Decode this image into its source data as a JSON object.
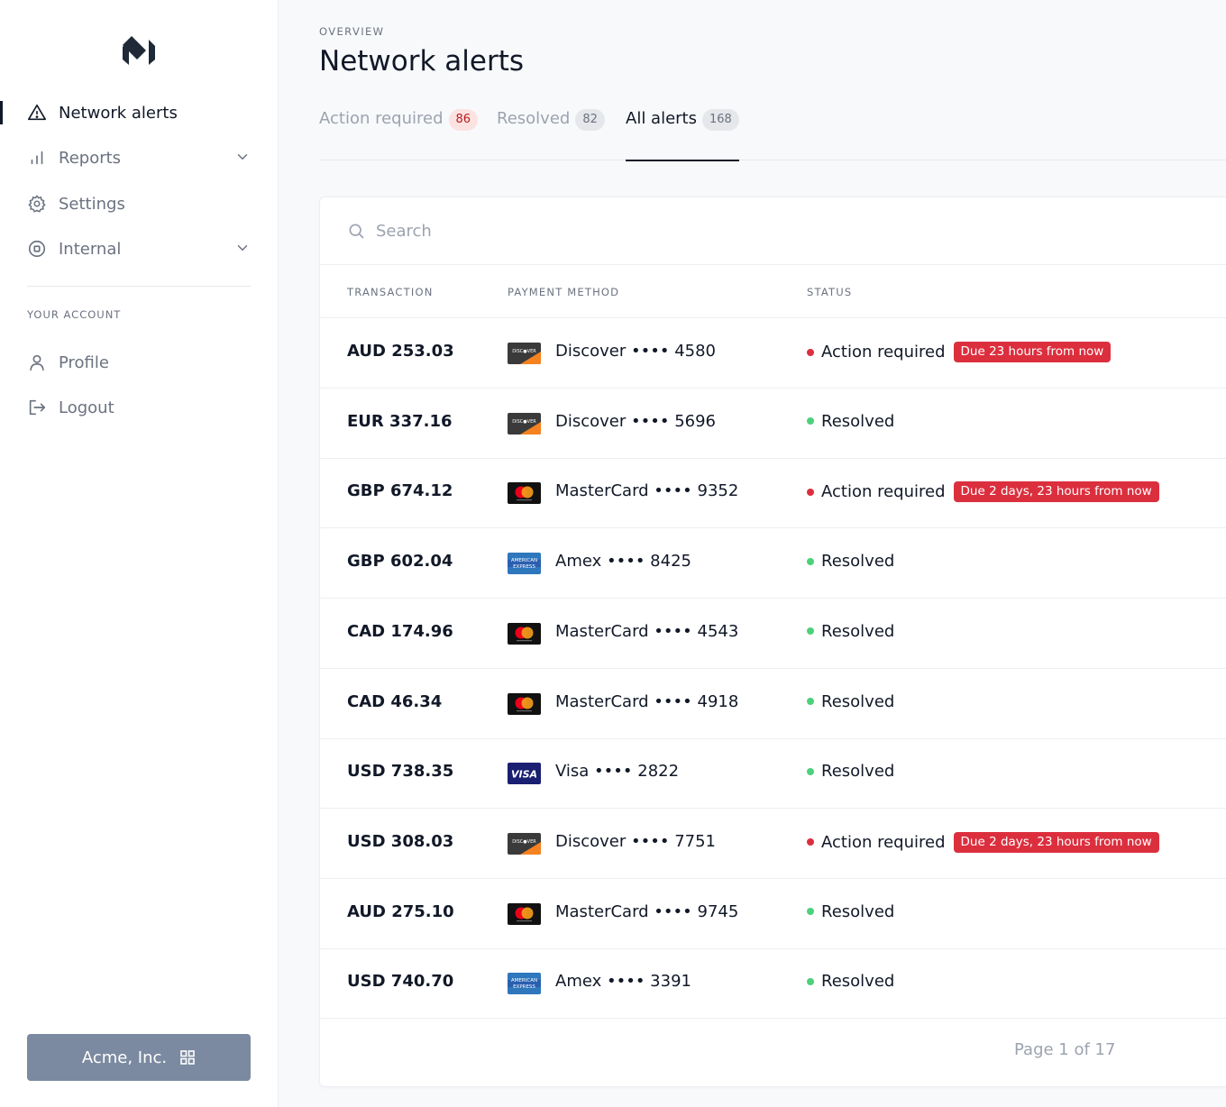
{
  "sidebar": {
    "nav": [
      {
        "label": "Network alerts",
        "icon": "alert-triangle-icon",
        "active": true
      },
      {
        "label": "Reports",
        "icon": "bar-chart-icon",
        "expandable": true
      },
      {
        "label": "Settings",
        "icon": "gear-icon"
      },
      {
        "label": "Internal",
        "icon": "stop-circle-icon",
        "expandable": true
      }
    ],
    "account_section_label": "YOUR ACCOUNT",
    "account_nav": [
      {
        "label": "Profile",
        "icon": "user-icon"
      },
      {
        "label": "Logout",
        "icon": "logout-icon"
      }
    ],
    "org_button_label": "Acme, Inc."
  },
  "header": {
    "eyebrow": "OVERVIEW",
    "title": "Network alerts"
  },
  "tabs": [
    {
      "label": "Action required",
      "count": "86",
      "count_style": "red"
    },
    {
      "label": "Resolved",
      "count": "82",
      "count_style": "gray"
    },
    {
      "label": "All alerts",
      "count": "168",
      "count_style": "gray",
      "active": true
    }
  ],
  "search": {
    "placeholder": "Search",
    "value": ""
  },
  "table": {
    "columns": [
      "TRANSACTION",
      "PAYMENT METHOD",
      "STATUS"
    ],
    "rows": [
      {
        "amount": "AUD 253.03",
        "brand": "discover",
        "method": "Discover •••• 4580",
        "status": "Action required",
        "due": "Due 23 hours from now"
      },
      {
        "amount": "EUR 337.16",
        "brand": "discover",
        "method": "Discover •••• 5696",
        "status": "Resolved",
        "due": ""
      },
      {
        "amount": "GBP 674.12",
        "brand": "mastercard",
        "method": "MasterCard •••• 9352",
        "status": "Action required",
        "due": "Due 2 days, 23 hours from now"
      },
      {
        "amount": "GBP 602.04",
        "brand": "amex",
        "method": "Amex •••• 8425",
        "status": "Resolved",
        "due": ""
      },
      {
        "amount": "CAD 174.96",
        "brand": "mastercard",
        "method": "MasterCard •••• 4543",
        "status": "Resolved",
        "due": ""
      },
      {
        "amount": "CAD 46.34",
        "brand": "mastercard",
        "method": "MasterCard •••• 4918",
        "status": "Resolved",
        "due": ""
      },
      {
        "amount": "USD 738.35",
        "brand": "visa",
        "method": "Visa •••• 2822",
        "status": "Resolved",
        "due": ""
      },
      {
        "amount": "USD 308.03",
        "brand": "discover",
        "method": "Discover •••• 7751",
        "status": "Action required",
        "due": "Due 2 days, 23 hours from now"
      },
      {
        "amount": "AUD 275.10",
        "brand": "mastercard",
        "method": "MasterCard •••• 9745",
        "status": "Resolved",
        "due": ""
      },
      {
        "amount": "USD 740.70",
        "brand": "amex",
        "method": "Amex •••• 3391",
        "status": "Resolved",
        "due": ""
      }
    ]
  },
  "pagination": {
    "label": "Page 1 of 17"
  },
  "colors": {
    "status_action": "#dc2f3e",
    "status_resolved": "#4cd17a",
    "org_button": "#7b8aa0"
  }
}
